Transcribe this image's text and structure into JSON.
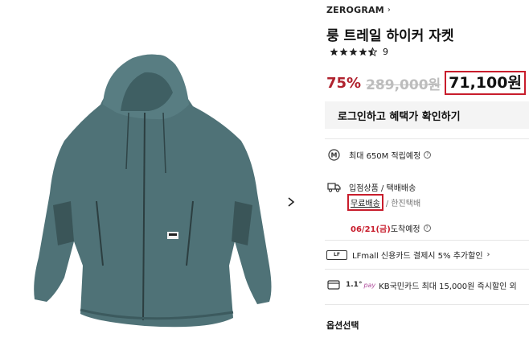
{
  "product_image": {
    "alt_icon": "jacket-image"
  },
  "nav": {
    "next_icon": "chevron-right-icon"
  },
  "brand": {
    "name": "ZEROGRAM",
    "chevron": "›"
  },
  "product": {
    "title": "룽 트레일 하이커 자켓",
    "rating": 4.5,
    "review_count": "9"
  },
  "price": {
    "discount": "75%",
    "original": "289,000원",
    "sale": "71,100원",
    "help": "?"
  },
  "login_button": {
    "label": "로그인하고 혜택가 확인하기"
  },
  "benefits": {
    "mileage": {
      "text": "최대 650M 적립예정",
      "help": "?",
      "icon": "mileage-icon"
    },
    "shipping": {
      "type": "입점상품 / 택배배송",
      "free": "무료배송",
      "carrier": "/ 한진택배",
      "arrival_date": "06/21(금)",
      "arrival_label": "도착예정",
      "help": "?",
      "icon": "truck-icon"
    },
    "card1": {
      "chip": "LF",
      "text": "LFmall 신용카드 결제시 5% 추가할인",
      "chevron": "›",
      "icon": "card-icon"
    },
    "card2": {
      "logo": "1.1°",
      "pay": "pay",
      "text": "KB국민카드 최대 15,000원 즉시할인 외",
      "icon": "card-icon"
    }
  },
  "options": {
    "label": "옵션선택"
  },
  "colors": {
    "accent_red": "#c81d2c",
    "discount_red": "#b0222e",
    "jacket": "#4f7277"
  }
}
